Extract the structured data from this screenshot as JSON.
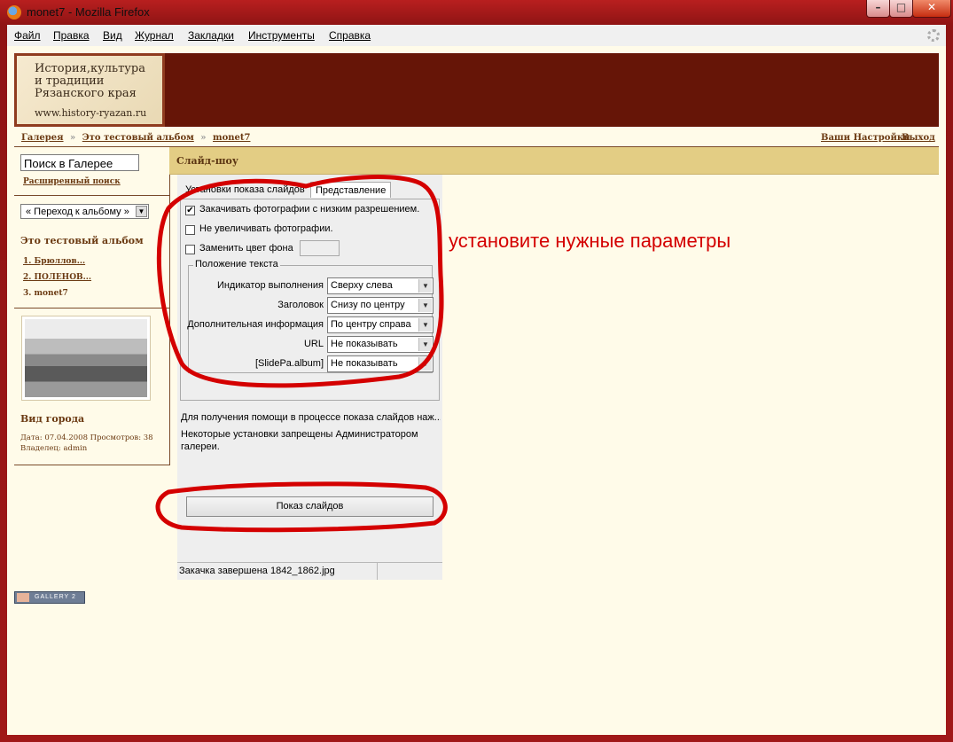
{
  "window": {
    "title": "monet7 - Mozilla Firefox",
    "min_glyph": "–",
    "max_glyph": "□",
    "close_glyph": "✕"
  },
  "menu": {
    "items": [
      "Файл",
      "Правка",
      "Вид",
      "Журнал",
      "Закладки",
      "Инструменты",
      "Справка"
    ]
  },
  "banner": {
    "logo_line1": "История,культура",
    "logo_line2": "и традиции",
    "logo_line3": "Рязанского края",
    "logo_url": "www.history-ryazan.ru"
  },
  "breadcrumb": {
    "items": [
      "Галерея",
      "Это тестовый альбом",
      "monet7"
    ],
    "separator": "»"
  },
  "top_links": {
    "settings": "Ваши Настройки",
    "logout": "Выход"
  },
  "sidebar": {
    "search_value": "Поиск в Галерее",
    "advanced_search": "Расширенный поиск",
    "album_jump": "« Переход к альбому »",
    "album_title": "Это тестовый альбом",
    "album_items": [
      "1. Брюллов...",
      "2. ПОЛЕНОВ...",
      "3. monet7"
    ],
    "photo_title": "Вид города",
    "photo_meta_line1": "Дата: 07.04.2008 Просмотров: 38",
    "photo_meta_line2": "Владелец: admin"
  },
  "main": {
    "title": "Слайд-шоу"
  },
  "applet": {
    "tabs": [
      "Установки показа слайдов",
      "Представление"
    ],
    "active_tab": "Представление",
    "checkboxes": [
      {
        "label": "Закачивать фотографии с низким разрешением.",
        "checked": true
      },
      {
        "label": "Не увеличивать фотографии.",
        "checked": false
      },
      {
        "label": "Заменить цвет фона",
        "checked": false
      }
    ],
    "fieldset_legend": "Положение текста",
    "fields": [
      {
        "label": "Индикатор выполнения",
        "value": "Сверху слева"
      },
      {
        "label": "Заголовок",
        "value": "Снизу по центру"
      },
      {
        "label": "Дополнительная информация",
        "value": "По центру справа"
      },
      {
        "label": "URL",
        "value": "Не показывать"
      },
      {
        "label": "[SlidePa.album]",
        "value": "Не показывать"
      }
    ],
    "help_text": "Для получения помощи в процессе показа слайдов наж...",
    "permission_text": "Некоторые установки запрещены Администратором галереи.",
    "start_button": "Показ слайдов",
    "status_text": "Закачка завершена 1842_1862.jpg"
  },
  "footer": {
    "badge": "GALLERY 2"
  },
  "annotation": {
    "text": "установите нужные параметры",
    "color": "#d40000"
  },
  "colors": {
    "banner": "#661507",
    "page_bg": "#fffbe9",
    "header_bar": "#e3cd84",
    "link": "#6b3a12"
  }
}
